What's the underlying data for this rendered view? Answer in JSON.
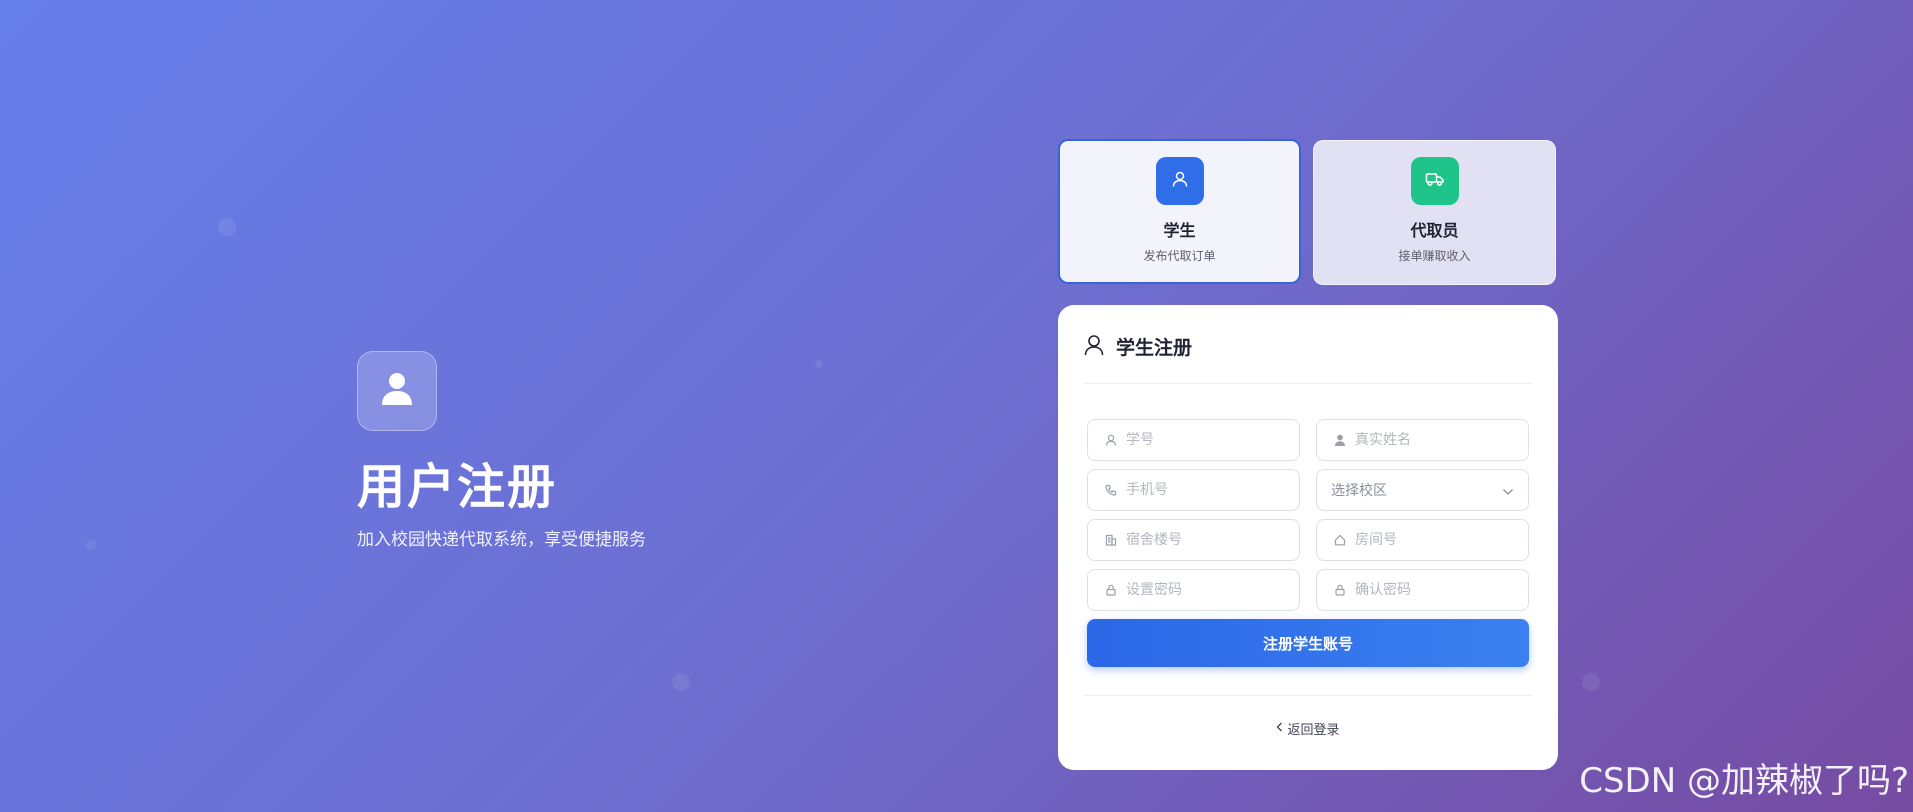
{
  "hero": {
    "title": "用户注册",
    "subtitle": "加入校园快递代取系统，享受便捷服务",
    "icon": "user-icon"
  },
  "roles": [
    {
      "title": "学生",
      "desc": "发布代取订单",
      "icon": "user-icon",
      "color": "#2f6ee8",
      "selected": true
    },
    {
      "title": "代取员",
      "desc": "接单赚取收入",
      "icon": "truck-icon",
      "color": "#1fc48b",
      "selected": false
    }
  ],
  "form": {
    "title": "学生注册",
    "fields": {
      "student_id": {
        "placeholder": "学号",
        "value": ""
      },
      "real_name": {
        "placeholder": "真实姓名",
        "value": ""
      },
      "phone": {
        "placeholder": "手机号",
        "value": ""
      },
      "campus": {
        "selected": "选择校区"
      },
      "dorm": {
        "placeholder": "宿舍楼号",
        "value": ""
      },
      "room": {
        "placeholder": "房间号",
        "value": ""
      },
      "password": {
        "placeholder": "设置密码",
        "value": ""
      },
      "confirm_password": {
        "placeholder": "确认密码",
        "value": ""
      }
    },
    "submit_label": "注册学生账号",
    "back_label": "返回登录"
  },
  "watermark": "CSDN @加辣椒了吗?",
  "colors": {
    "accent": "#2b67e6",
    "bg_start": "#667eea",
    "bg_end": "#764ba2",
    "courier_green": "#1fc48b"
  }
}
